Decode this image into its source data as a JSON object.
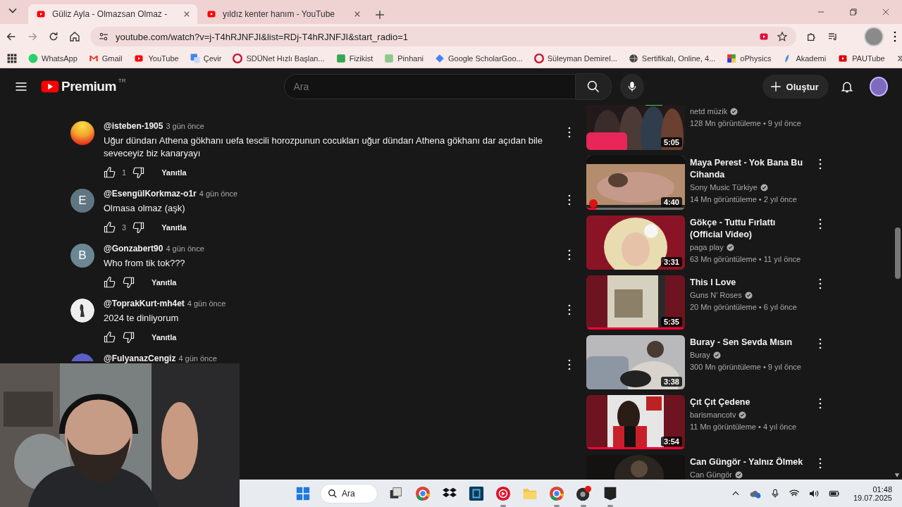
{
  "browser": {
    "tabs": [
      {
        "title": "Güliz Ayla - Olmazsan Olmaz -",
        "selected": true
      },
      {
        "title": "yıldız kenter hanım - YouTube",
        "selected": false
      }
    ],
    "address": "youtube.com/watch?v=j-T4hRJNFJI&list=RDj-T4hRJNFJI&start_radio=1",
    "bookmarks": [
      "WhatsApp",
      "Gmail",
      "YouTube",
      "Çevir",
      "SDÜNet Hızlı Başlan...",
      "Fizikist",
      "Pinhani",
      "Google ScholarGoo...",
      "Süleyman Demirel...",
      "Sertifikalı, Online, 4...",
      "oPhysics",
      "Akademi",
      "PAUTube"
    ]
  },
  "youtube": {
    "logo": "Premium",
    "region": "TR",
    "search_placeholder": "Ara",
    "create": "Oluştur",
    "comments": [
      {
        "author": "@isteben-1905",
        "time": "3 gün önce",
        "text": "Uğur dündarı Athena gökhanı uefa tescili horozpunun cocukları uğur dündarı Athena gökhanı dar açıdan bile seveceyiz biz kanaryayı",
        "likes": "1",
        "reply": "Yanıtla",
        "avatar": {
          "kind": "gradient"
        }
      },
      {
        "author": "@EsengülKorkmaz-o1r",
        "time": "4 gün önce",
        "text": "Olmasa olmaz (aşk)",
        "likes": "3",
        "reply": "Yanıtla",
        "avatar": {
          "kind": "letter",
          "letter": "E",
          "color": "#5f7582"
        }
      },
      {
        "author": "@Gonzabert90",
        "time": "4 gün önce",
        "text": "Who from tik tok???",
        "reply": "Yanıtla",
        "avatar": {
          "kind": "letter",
          "letter": "B",
          "color": "#6b8794"
        }
      },
      {
        "author": "@ToprakKurt-mh4et",
        "time": "4 gün önce",
        "text": "2024 te dinliyorum",
        "reply": "Yanıtla"
      },
      {
        "author": "@FulyanazCengiz",
        "time": "4 gün önce",
        "avatar": {
          "kind": "plain",
          "color": "#5c5fc6"
        }
      }
    ],
    "videos": [
      {
        "channel": "netd müzik",
        "meta": "128 Mn görüntüleme • 9 yıl önce",
        "duration": "5:05"
      },
      {
        "title": "Maya Perest  - Yok Bana Bu Cihanda",
        "channel": "Sony Music Türkiye",
        "meta": "14 Mn görüntüleme • 2 yıl önce",
        "duration": "4:40",
        "level": 0.1
      },
      {
        "title": "Gökçe - Tuttu Fırlattı (Official Video)",
        "channel": "paga play",
        "meta": "63 Mn görüntüleme • 11 yıl önce",
        "duration": "3:31"
      },
      {
        "title": "This I Love",
        "channel": "Guns N' Roses",
        "meta": "20 Mn görüntüleme • 6 yıl önce",
        "duration": "5:35",
        "level": 1
      },
      {
        "title": "Buray - Sen Sevda Mısın",
        "channel": "Buray",
        "meta": "300 Mn görüntüleme • 9 yıl önce",
        "duration": "3:38"
      },
      {
        "title": "Çıt Çıt Çedene",
        "channel": "barismancotv",
        "meta": "11 Mn görüntüleme • 4 yıl önce",
        "duration": "3:54",
        "level": 1
      },
      {
        "title": "Can Güngör - Yalnız Ölmek",
        "channel": "Can Güngör"
      }
    ]
  },
  "taskbar": {
    "search": "Ara",
    "apps": [
      {
        "running": false
      },
      {
        "running": false
      },
      {
        "running": false
      },
      {
        "running": false
      },
      {
        "running": true
      },
      {
        "running": false
      },
      {
        "running": true
      },
      {
        "running": true
      },
      {
        "running": true
      }
    ],
    "time": "01:48",
    "date": "19.07.2025"
  }
}
